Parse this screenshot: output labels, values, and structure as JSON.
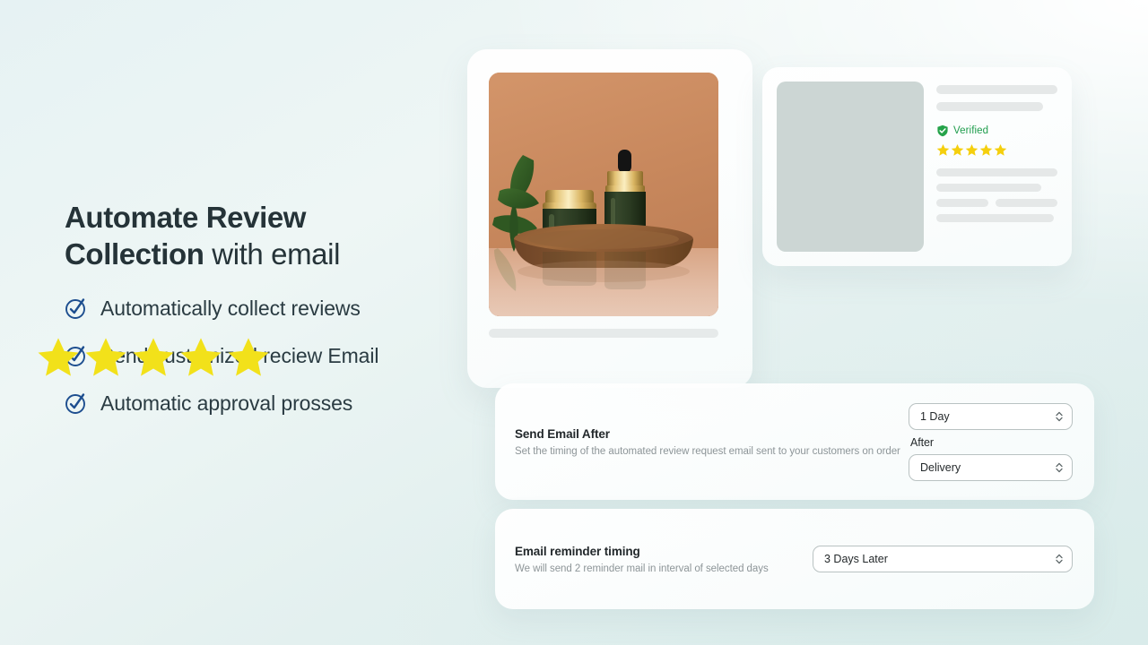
{
  "theme": {
    "background_top_left": "#e6f2f3",
    "background_bottom_right": "#dcecec",
    "heading_color": "#253338",
    "check_icon_color": "#1d4e8f",
    "star_color": "#f2e11a",
    "verified_green": "#1f9d4d",
    "skeleton_gray": "#e5e8e8",
    "image_placeholder_gray": "#ccd6d4"
  },
  "hero": {
    "headline_strong_1": "Automate Review",
    "headline_strong_2": "Collection",
    "headline_regular": " with email",
    "features": [
      {
        "icon": "check-circle-icon",
        "label": "Automatically collect reviews"
      },
      {
        "icon": "check-circle-icon",
        "label": "Send customized reciew Email"
      },
      {
        "icon": "check-circle-icon",
        "label": "Automatic approval prosses"
      }
    ]
  },
  "product_card": {
    "photo_alt": "skincare jar and dropper bottle on wooden tray",
    "photo_icon": "product-photo",
    "rating_stars": 5,
    "star_icon": "star-icon"
  },
  "review_card": {
    "thumbnail_icon": "image-placeholder",
    "verified_badge": {
      "icon": "shield-check-icon",
      "label": "Verified"
    },
    "rating_stars": 5,
    "star_icon": "star-icon"
  },
  "settings": [
    {
      "title": "Send Email After",
      "description": "Set the timing of the automated review request email sent to your customers on order",
      "controls": [
        {
          "type": "select",
          "name": "send-email-delay",
          "value": "1 Day",
          "icon": "stepper-chevrons-icon"
        },
        {
          "type": "label",
          "name": "after-label",
          "value": "After"
        },
        {
          "type": "select",
          "name": "send-email-trigger",
          "value": "Delivery",
          "icon": "stepper-chevrons-icon"
        }
      ]
    },
    {
      "title": "Email reminder timing",
      "description": "We will send 2 reminder mail in interval of selected days",
      "controls": [
        {
          "type": "select",
          "name": "reminder-interval",
          "value": "3 Days Later",
          "icon": "stepper-chevrons-icon"
        }
      ]
    }
  ]
}
